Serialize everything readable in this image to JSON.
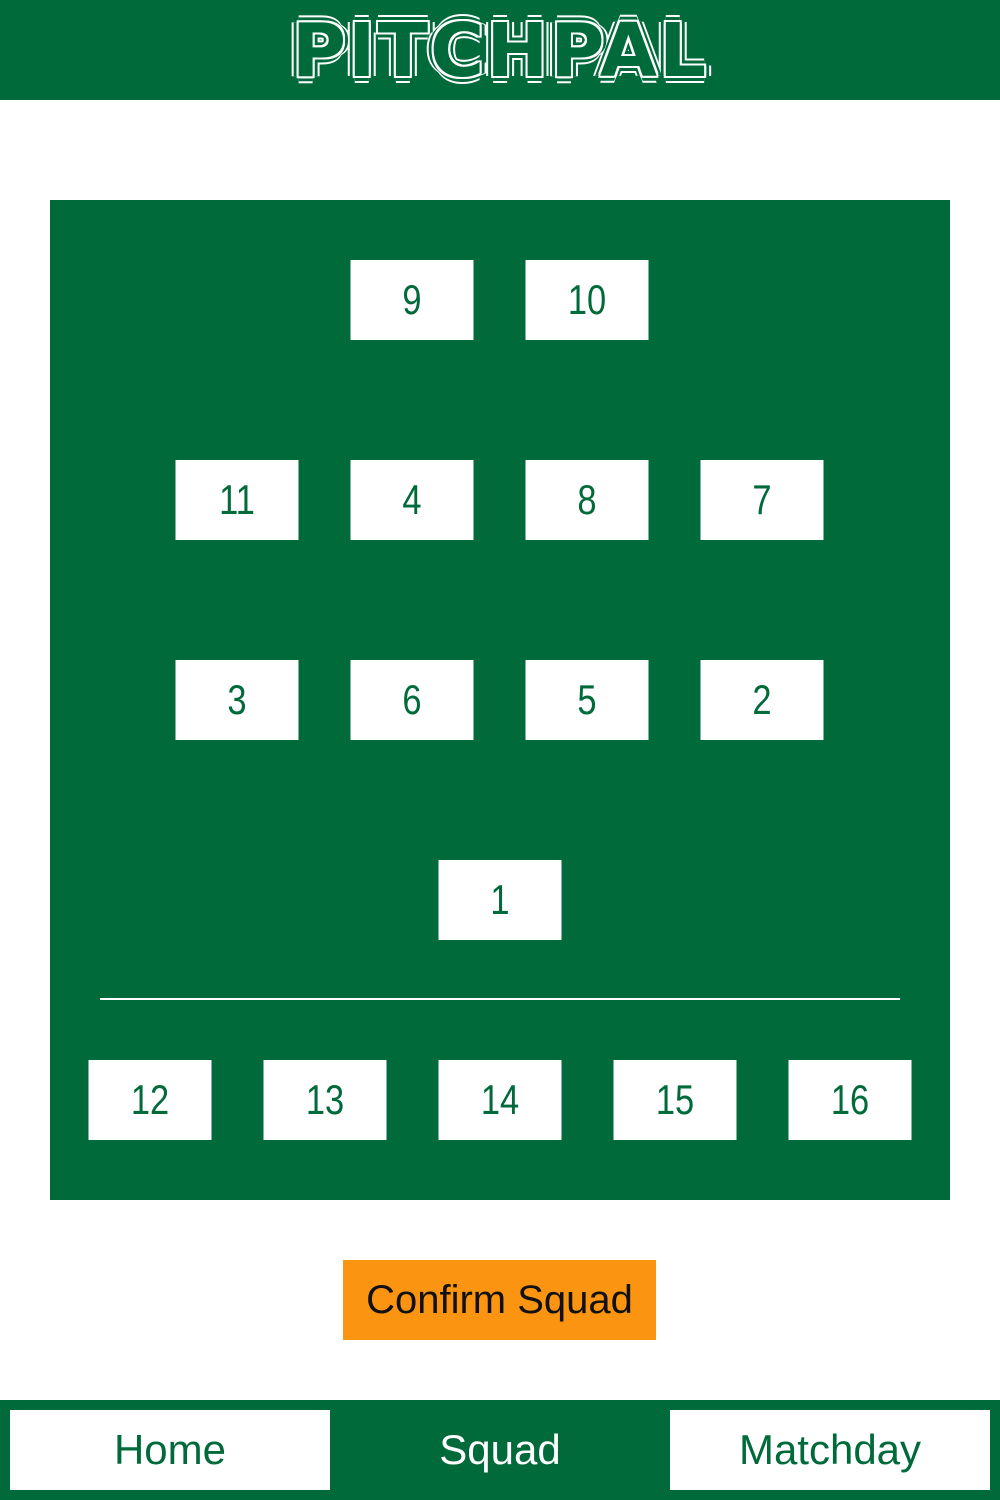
{
  "app": {
    "title": "PITCHPAL"
  },
  "colors": {
    "brand_green": "#006a3b",
    "accent_orange": "#fa9411",
    "white": "#ffffff"
  },
  "pitch": {
    "forwards": [
      "9",
      "10"
    ],
    "midfielders": [
      "11",
      "4",
      "8",
      "7"
    ],
    "defenders": [
      "3",
      "6",
      "5",
      "2"
    ],
    "goalkeeper": [
      "1"
    ],
    "substitutes": [
      "12",
      "13",
      "14",
      "15",
      "16"
    ]
  },
  "actions": {
    "confirm_label": "Confirm Squad"
  },
  "nav": {
    "items": [
      {
        "label": "Home",
        "active": false
      },
      {
        "label": "Squad",
        "active": true
      },
      {
        "label": "Matchday",
        "active": false
      }
    ]
  }
}
